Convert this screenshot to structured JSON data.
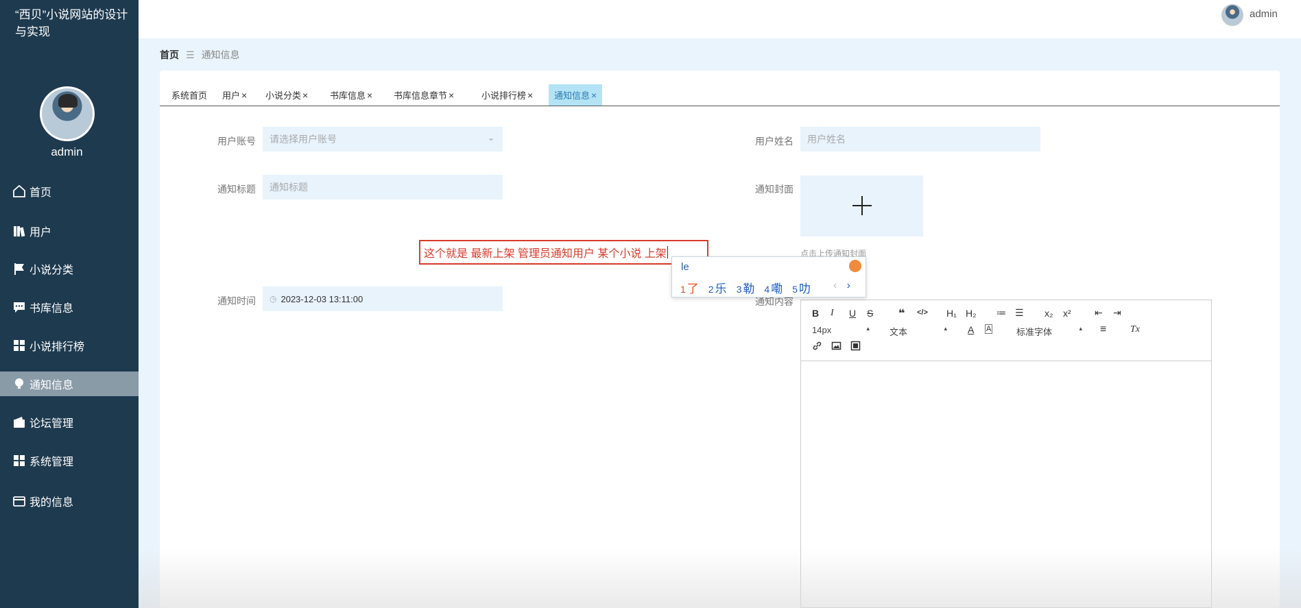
{
  "sidebar": {
    "title": "“西贝”小说网站的设计与实现",
    "user_name": "admin",
    "items": [
      {
        "label": "首页",
        "icon": "home-icon"
      },
      {
        "label": "用户",
        "icon": "books-icon"
      },
      {
        "label": "小说分类",
        "icon": "flag-icon"
      },
      {
        "label": "书库信息",
        "icon": "chat-icon"
      },
      {
        "label": "小说排行榜",
        "icon": "grid-icon"
      },
      {
        "label": "通知信息",
        "icon": "bulb-icon"
      },
      {
        "label": "论坛管理",
        "icon": "wallet-icon"
      },
      {
        "label": "系统管理",
        "icon": "grid-icon"
      },
      {
        "label": "我的信息",
        "icon": "card-icon"
      }
    ],
    "active_item": "通知信息"
  },
  "topbar": {
    "username": "admin"
  },
  "breadcrumb": {
    "home": "首页",
    "current": "通知信息"
  },
  "tabs": [
    {
      "label": "系统首页",
      "closable": false
    },
    {
      "label": "用户",
      "closable": true
    },
    {
      "label": "小说分类",
      "closable": true
    },
    {
      "label": "书库信息",
      "closable": true
    },
    {
      "label": "书库信息章节",
      "closable": true
    },
    {
      "label": "小说排行榜",
      "closable": true
    },
    {
      "label": "通知信息",
      "closable": true
    }
  ],
  "close_glyph": "×",
  "form": {
    "user_account_label": "用户账号",
    "user_account_placeholder": "请选择用户账号",
    "user_name_label": "用户姓名",
    "user_name_placeholder": "用户姓名",
    "notice_title_label": "通知标题",
    "notice_title_placeholder": "通知标题",
    "notice_cover_label": "通知封面",
    "upload_hint": "点击上传通知封面",
    "notice_time_label": "通知时间",
    "notice_time_value": "2023-12-03 13:11:00",
    "notice_content_label": "通知内容"
  },
  "highlight_text": "这个就是 最新上架  管理员通知用户 某个小说 上架",
  "ime": {
    "input": "le",
    "candidates": [
      {
        "n": "1",
        "text": "了"
      },
      {
        "n": "2",
        "text": "乐"
      },
      {
        "n": "3",
        "text": "勒"
      },
      {
        "n": "4",
        "text": "嘞"
      },
      {
        "n": "5",
        "text": "叻"
      }
    ],
    "prev": "‹",
    "next": "›"
  },
  "editor": {
    "font_size": "14px",
    "paragraph": "文本",
    "font_family": "标准字体",
    "buttons": {
      "bold": "B",
      "italic": "I",
      "underline": "U",
      "strike": "S",
      "quote": "❝",
      "code": "</>",
      "h1": "H₁",
      "h2": "H₂",
      "ol": "≔",
      "ul": "☰",
      "sub": "x₂",
      "sup": "x²",
      "outdent": "⇤",
      "indent": "⇥",
      "color": "A",
      "bg": "A",
      "align": "≡",
      "clean": "Tx",
      "link": "🔗",
      "image": "▣",
      "video": "▦"
    }
  }
}
